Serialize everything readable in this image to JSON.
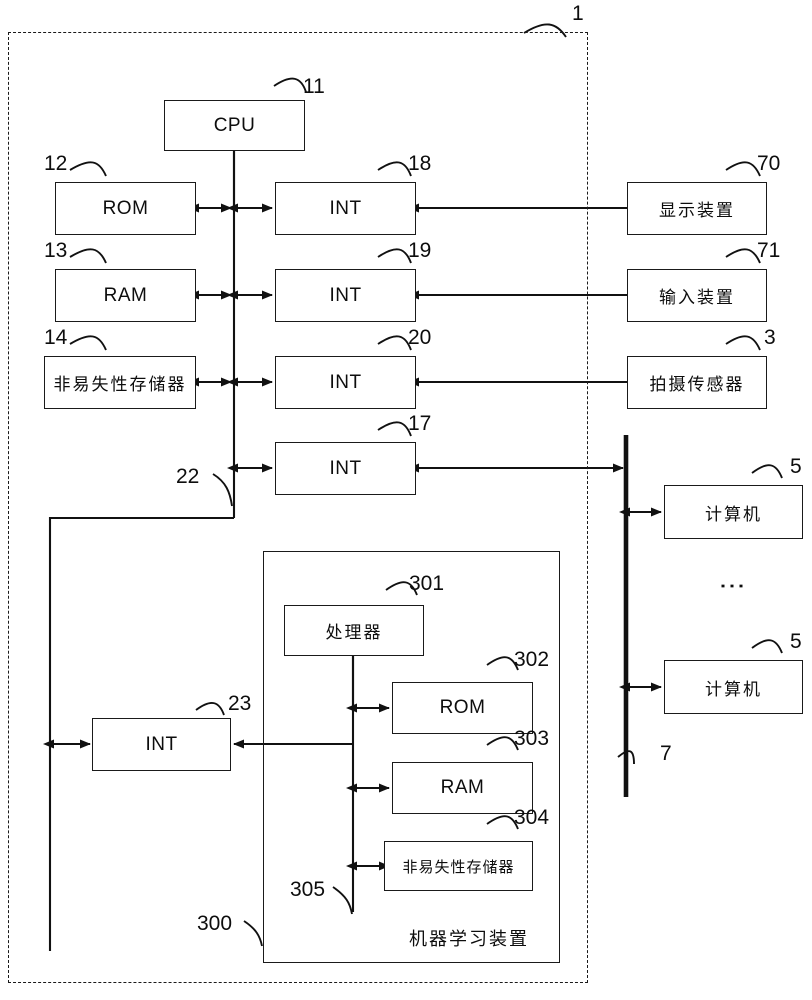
{
  "figure": {
    "type": "patent-block-diagram",
    "outer_enclosure_ref": "1",
    "machine_learning_device_title": "机器学习装置",
    "machine_learning_device_ref": "300",
    "internal_bus_ref_main": "22",
    "internal_bus_ref_ml": "305",
    "network_bus_ref": "7",
    "vertical_dots": "⋮"
  },
  "blocks": {
    "cpu": {
      "label": "CPU",
      "ref": "11"
    },
    "rom": {
      "label": "ROM",
      "ref": "12"
    },
    "ram": {
      "label": "RAM",
      "ref": "13"
    },
    "nvm": {
      "label": "非易失性存储器",
      "ref": "14"
    },
    "int18": {
      "label": "INT",
      "ref": "18"
    },
    "int19": {
      "label": "INT",
      "ref": "19"
    },
    "int20": {
      "label": "INT",
      "ref": "20"
    },
    "int17": {
      "label": "INT",
      "ref": "17"
    },
    "int23": {
      "label": "INT",
      "ref": "23"
    },
    "display": {
      "label": "显示装置",
      "ref": "70"
    },
    "input": {
      "label": "输入装置",
      "ref": "71"
    },
    "sensor": {
      "label": "拍摄传感器",
      "ref": "3"
    },
    "computer1": {
      "label": "计算机",
      "ref": "5"
    },
    "computer2": {
      "label": "计算机",
      "ref": "5"
    },
    "processor": {
      "label": "处理器",
      "ref": "301"
    },
    "ml_rom": {
      "label": "ROM",
      "ref": "302"
    },
    "ml_ram": {
      "label": "RAM",
      "ref": "303"
    },
    "ml_nvm": {
      "label": "非易失性存储器",
      "ref": "304"
    }
  },
  "colors": {
    "line": "#1a1a1a",
    "text": "#0d0d0d",
    "background": "#ffffff"
  }
}
